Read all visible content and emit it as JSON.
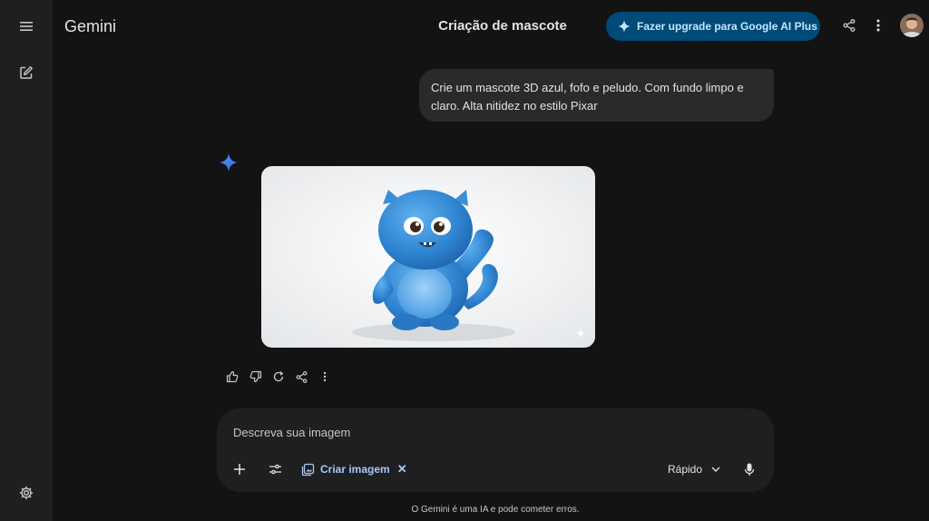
{
  "app": {
    "title": "Gemini"
  },
  "header": {
    "chat_title": "Criação de mascote",
    "upgrade_label": "Fazer upgrade para Google AI Plus",
    "icons": [
      "menu-icon",
      "new-chat-icon",
      "settings-icon",
      "share-icon",
      "more-vert-icon",
      "avatar"
    ]
  },
  "conversation": {
    "user_prompt": "Crie um mascote 3D azul, fofo e peludo. Com fundo limpo e claro. Alta nitidez no estilo Pixar",
    "response": {
      "type": "generated-image",
      "subject": "blue fluffy 3D mascot",
      "actions": [
        "thumb-up-icon",
        "thumb-down-icon",
        "regenerate-icon",
        "share-icon",
        "more-vert-icon"
      ]
    }
  },
  "composer": {
    "placeholder": "Descreva sua imagem",
    "value": "",
    "tool_chip_label": "Criar imagem",
    "mode_label": "Rápido"
  },
  "footer": {
    "disclaimer": "O Gemini é uma IA e pode cometer erros."
  },
  "colors": {
    "background": "#131314",
    "sidebar": "#1e1f20",
    "upgrade_button": "#004a77",
    "accent": "#a8c7fa",
    "bubble": "#282a2c"
  }
}
